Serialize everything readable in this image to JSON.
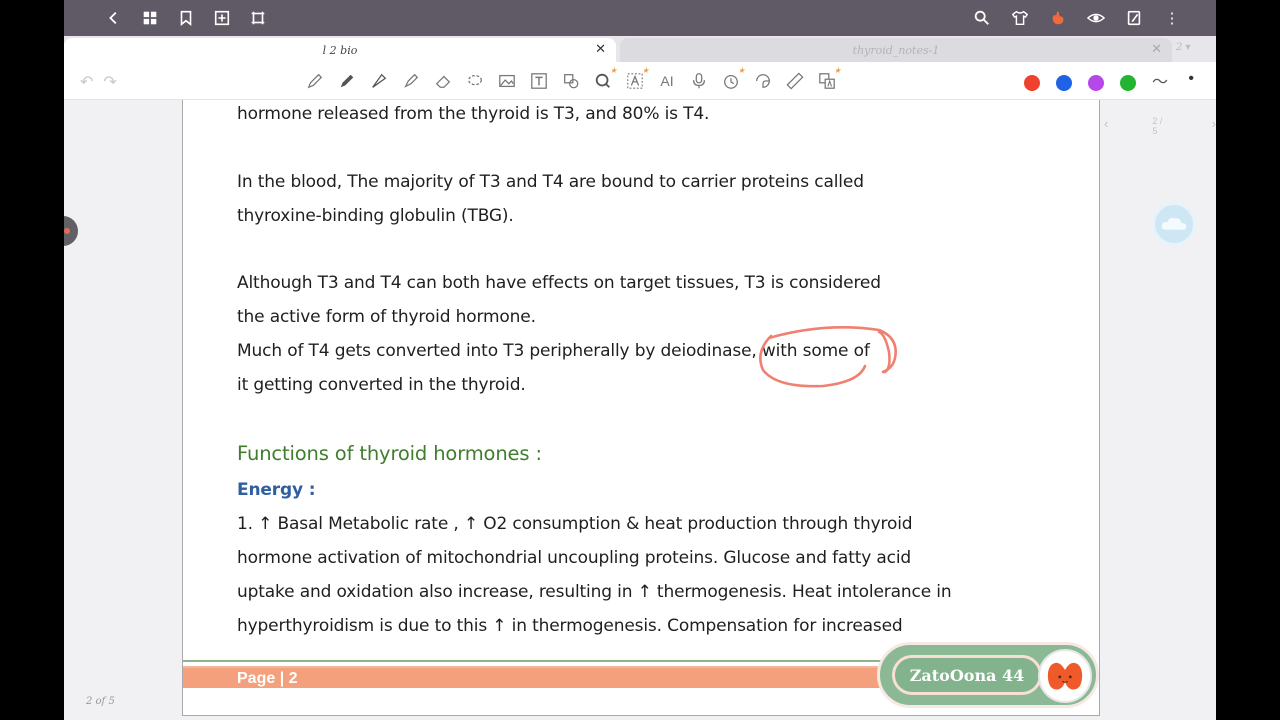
{
  "tabs": {
    "active": {
      "label": "l 2 bio"
    },
    "inactive": {
      "label": "thyroid_notes-1"
    },
    "more": "2 ▾"
  },
  "toolbar": {
    "colors": [
      "#f0402e",
      "#1e63e6",
      "#b647e8",
      "#21b531",
      "#8a8a8a"
    ]
  },
  "document": {
    "paragraphs": [
      "hormone released from the thyroid is T3, and 80% is T4.",
      "In the blood, The majority of T3 and T4 are bound to carrier proteins called",
      "thyroxine-binding globulin (TBG).",
      "Although T3 and T4 can both have effects on target tissues, T3 is considered",
      "the active form of thyroid hormone.",
      "Much of T4 gets converted into T3 peripherally by deiodinase, with some of",
      "it getting converted in the thyroid.",
      "Functions of thyroid hormones :",
      "Energy :",
      "1. ↑ Basal Metabolic rate , ↑ O2 consumption & heat production through thyroid",
      "hormone activation of mitochondrial uncoupling proteins. Glucose and fatty acid",
      "uptake and oxidation also increase, resulting in ↑ thermogenesis. Heat intolerance in",
      "hyperthyroidism is due to this ↑ in thermogenesis. Compensation for increased"
    ],
    "annotation_color": "#f08070"
  },
  "footer": {
    "page_label": "Page | 2",
    "badge_text": "ZatoOona 44"
  },
  "page_nav": {
    "indicator": "2 / 5"
  },
  "page_count": "2 of 5"
}
